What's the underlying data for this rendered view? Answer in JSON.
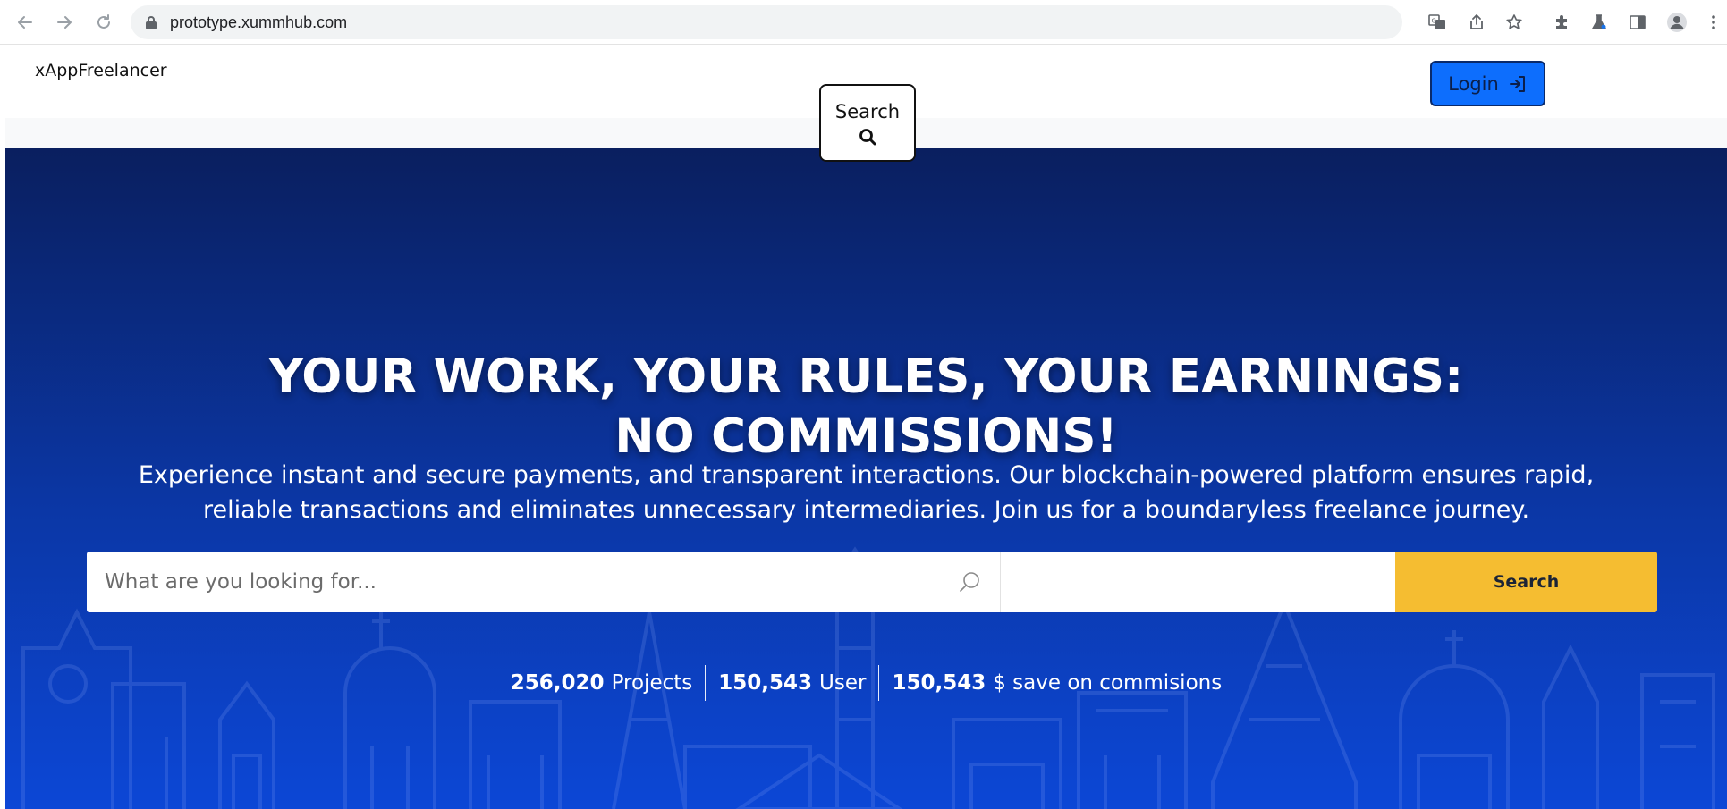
{
  "browser": {
    "url": "prototype.xummhub.com"
  },
  "header": {
    "brand": "xAppFreelancer",
    "search_label": "Search",
    "login_label": "Login"
  },
  "hero": {
    "title_line1": "YOUR WORK, YOUR RULES, YOUR EARNINGS:",
    "title_line2": "NO COMMISSIONS!",
    "subtitle_line1": "Experience instant and secure payments, and transparent interactions. Our blockchain-powered platform ensures rapid,",
    "subtitle_line2": "reliable transactions and eliminates unnecessary intermediaries. Join us for a boundaryless freelance journey.",
    "search_placeholder": "What are you looking for...",
    "location_value": "",
    "search_button": "Search"
  },
  "stats": [
    {
      "value": "256,020",
      "label": "Projects"
    },
    {
      "value": "150,543",
      "label": "User"
    },
    {
      "value": "150,543",
      "label": "$ save on commisions"
    }
  ],
  "colors": {
    "accent_yellow": "#f5bd31",
    "login_blue": "#0d6efd",
    "hero_top": "#0a1f5f",
    "hero_bottom": "#0c47d6"
  }
}
